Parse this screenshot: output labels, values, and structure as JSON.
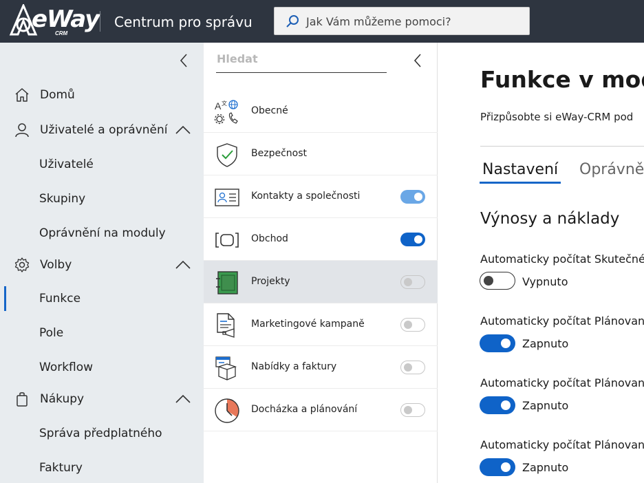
{
  "topbar": {
    "logo_text": "eWay",
    "logo_sub": "CRM",
    "app_title": "Centrum pro správu",
    "search_placeholder": "Jak Vám můžeme pomoci?"
  },
  "leftnav": {
    "items": [
      {
        "label": "Domů",
        "icon": "home-icon"
      },
      {
        "label": "Uživatelé a oprávnění",
        "icon": "user-icon",
        "expanded": true,
        "children": [
          "Uživatelé",
          "Skupiny",
          "Oprávnění na moduly"
        ]
      },
      {
        "label": "Volby",
        "icon": "gear-icon",
        "expanded": true,
        "children": [
          "Funkce",
          "Pole",
          "Workflow"
        ],
        "active_child": "Funkce"
      },
      {
        "label": "Nákupy",
        "icon": "shopping-bag-icon",
        "expanded": true,
        "children": [
          "Správa předplatného",
          "Faktury"
        ]
      }
    ]
  },
  "midpanel": {
    "search_placeholder": "Hledat",
    "modules": [
      {
        "label": "Obecné",
        "icon": "general-settings-icon",
        "toggle": null
      },
      {
        "label": "Bezpečnost",
        "icon": "shield-check-icon",
        "toggle": null
      },
      {
        "label": "Kontakty a společnosti",
        "icon": "contact-card-icon",
        "toggle": "on-disabled"
      },
      {
        "label": "Obchod",
        "icon": "deal-icon",
        "toggle": "on"
      },
      {
        "label": "Projekty",
        "icon": "project-book-icon",
        "toggle": "off",
        "selected": true
      },
      {
        "label": "Marketingové kampaně",
        "icon": "marketing-document-icon",
        "toggle": "off"
      },
      {
        "label": "Nabídky a faktury",
        "icon": "offer-box-icon",
        "toggle": "off"
      },
      {
        "label": "Docházka a plánování",
        "icon": "clock-planning-icon",
        "toggle": "off"
      }
    ]
  },
  "main": {
    "title": "Funkce v modu",
    "subtitle": "Přizpůsobte si eWay-CRM pod",
    "tabs": [
      "Nastavení",
      "Oprávně"
    ],
    "section_title": "Výnosy a náklady",
    "settings": [
      {
        "label": "Automaticky počítat Skutečné",
        "state": "Vypnuto",
        "on": false
      },
      {
        "label": "Automaticky počítat Plánovan",
        "state": "Zapnuto",
        "on": true
      },
      {
        "label": "Automaticky počítat Plánovan",
        "state": "Zapnuto",
        "on": true
      },
      {
        "label": "Automaticky počítat Plánovan",
        "state": "Zapnuto",
        "on": true
      }
    ]
  },
  "colors": {
    "topbar": "#2e3540",
    "accent": "#0f63c8",
    "leftnav_bg": "#e8ecef",
    "selected_row": "#e1e4e8"
  }
}
